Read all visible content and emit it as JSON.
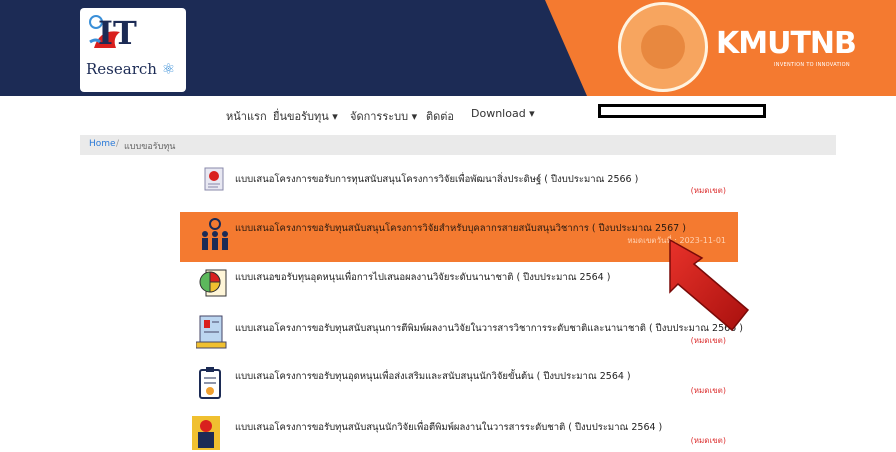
{
  "header": {
    "logo_text": "IT",
    "logo_sub": "Research",
    "brand": "KMUTNB",
    "tagline": "INVENTION TO INNOVATION"
  },
  "nav": {
    "home": "หน้าแรก",
    "apply": "ยื่นขอรับทุน ▾",
    "admin": "จัดการระบบ ▾",
    "contact": "ติดต่อ",
    "download": "Download ▾"
  },
  "breadcrumb": {
    "home": "Home",
    "sep": "/",
    "current": "แบบขอรับทุน"
  },
  "items": [
    {
      "title": "แบบเสนอโครงการขอรับการทุนสนับสนุนโครงการวิจัยเพื่อพัฒนาสิ่งประดิษฐ์ ( ปีงบประมาณ 2566 )",
      "status": "(หมดเขต)"
    },
    {
      "title": "แบบเสนอโครงการขอรับทุนสนับสนุนโครงการวิจัยสำหรับบุคลากรสายสนับสนุนวิชาการ ( ปีงบประมาณ 2567 )",
      "status": "หมดเขตวันที่ : 2023-11-01"
    },
    {
      "title": "แบบเสนอขอรับทุนอุดหนุนเพื่อการไปเสนอผลงานวิจัยระดับนานาชาติ ( ปีงบประมาณ 2564 )",
      "status": ""
    },
    {
      "title": "แบบเสนอโครงการขอรับทุนสนับสนุนการตีพิมพ์ผลงานวิจัยในวารสารวิชาการระดับชาติและนานาชาติ ( ปีงบประมาณ 2566 )",
      "status": "(หมดเขต)"
    },
    {
      "title": "แบบเสนอโครงการขอรับทุนอุดหนุนเพื่อส่งเสริมและสนับสนุนนักวิจัยขั้นต้น ( ปีงบประมาณ 2564 )",
      "status": "(หมดเขต)"
    },
    {
      "title": "แบบเสนอโครงการขอรับทุนสนับสนุนนักวิจัยเพื่อตีพิมพ์ผลงานในวารสารระดับชาติ ( ปีงบประมาณ 2564 )",
      "status": "(หมดเขต)"
    }
  ],
  "colors": {
    "navy": "#1c2b55",
    "orange": "#f47a30",
    "arrow": "#d9201e",
    "status": "#dd3333"
  }
}
